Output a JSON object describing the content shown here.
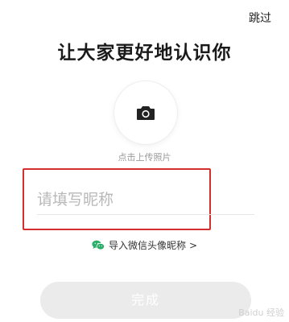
{
  "header": {
    "skip_label": "跳过",
    "title": "让大家更好地认识你"
  },
  "avatar": {
    "upload_label": "点击上传照片",
    "icon": "camera-icon"
  },
  "nickname": {
    "placeholder": "请填写昵称",
    "value": ""
  },
  "wechat_import": {
    "label": "导入微信头像昵称",
    "icon": "wechat-icon",
    "chevron": ">"
  },
  "footer": {
    "done_label": "完成"
  },
  "watermark": {
    "text": "Baidu 经验"
  },
  "colors": {
    "highlight_border": "#d32f2f",
    "wechat_green": "#2aae67",
    "disabled_button": "#ebebeb"
  }
}
